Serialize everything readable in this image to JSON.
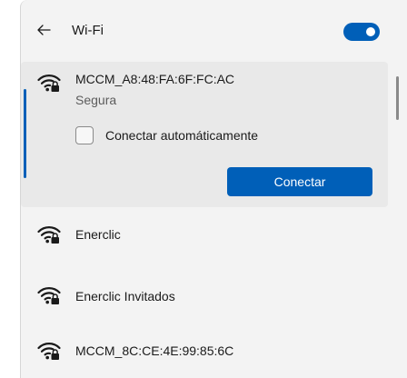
{
  "header": {
    "back_icon": "back-arrow-icon",
    "title": "Wi-Fi",
    "wifi_toggle_on": true,
    "accent_color": "#005fb8"
  },
  "selected_network": {
    "name": "MCCM_A8:48:FA:6F:FC:AC",
    "status": "Segura",
    "icon": "wifi-secured-icon",
    "auto_connect_label": "Conectar automáticamente",
    "auto_connect_checked": false,
    "connect_label": "Conectar"
  },
  "networks": [
    {
      "name": "Enerclic",
      "icon": "wifi-secured-icon"
    },
    {
      "name": "Enerclic Invitados",
      "icon": "wifi-secured-icon"
    },
    {
      "name": "MCCM_8C:CE:4E:99:85:6C",
      "icon": "wifi-secured-icon"
    }
  ]
}
